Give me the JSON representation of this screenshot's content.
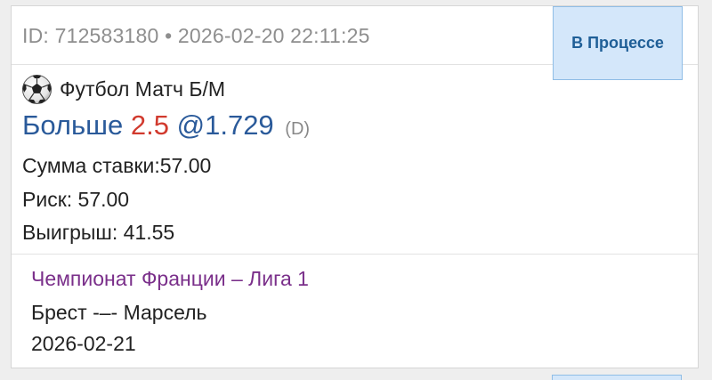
{
  "bet": {
    "header": "ID: 712583180 • 2026-02-20 22:11:25",
    "status": "В Процессе",
    "sport_icon": "soccer-ball-icon",
    "market": "Футбол Матч Б/М",
    "selection": "Больше",
    "line": "2.5",
    "odds": "@1.729",
    "odds_format": "(D)",
    "stake": "Сумма ставки:57.00",
    "risk": "Риск: 57.00",
    "win": "Выигрыш: 41.55",
    "league": "Чемпионат Франции – Лига 1",
    "teams": "Брест -–- Марсель",
    "event_date": "2026-02-21"
  },
  "colors": {
    "selection": "#2a5a9a",
    "line": "#d13a2e",
    "league": "#7a2f8a",
    "status_bg": "#d4e7fa",
    "status_text": "#1f5f97"
  }
}
